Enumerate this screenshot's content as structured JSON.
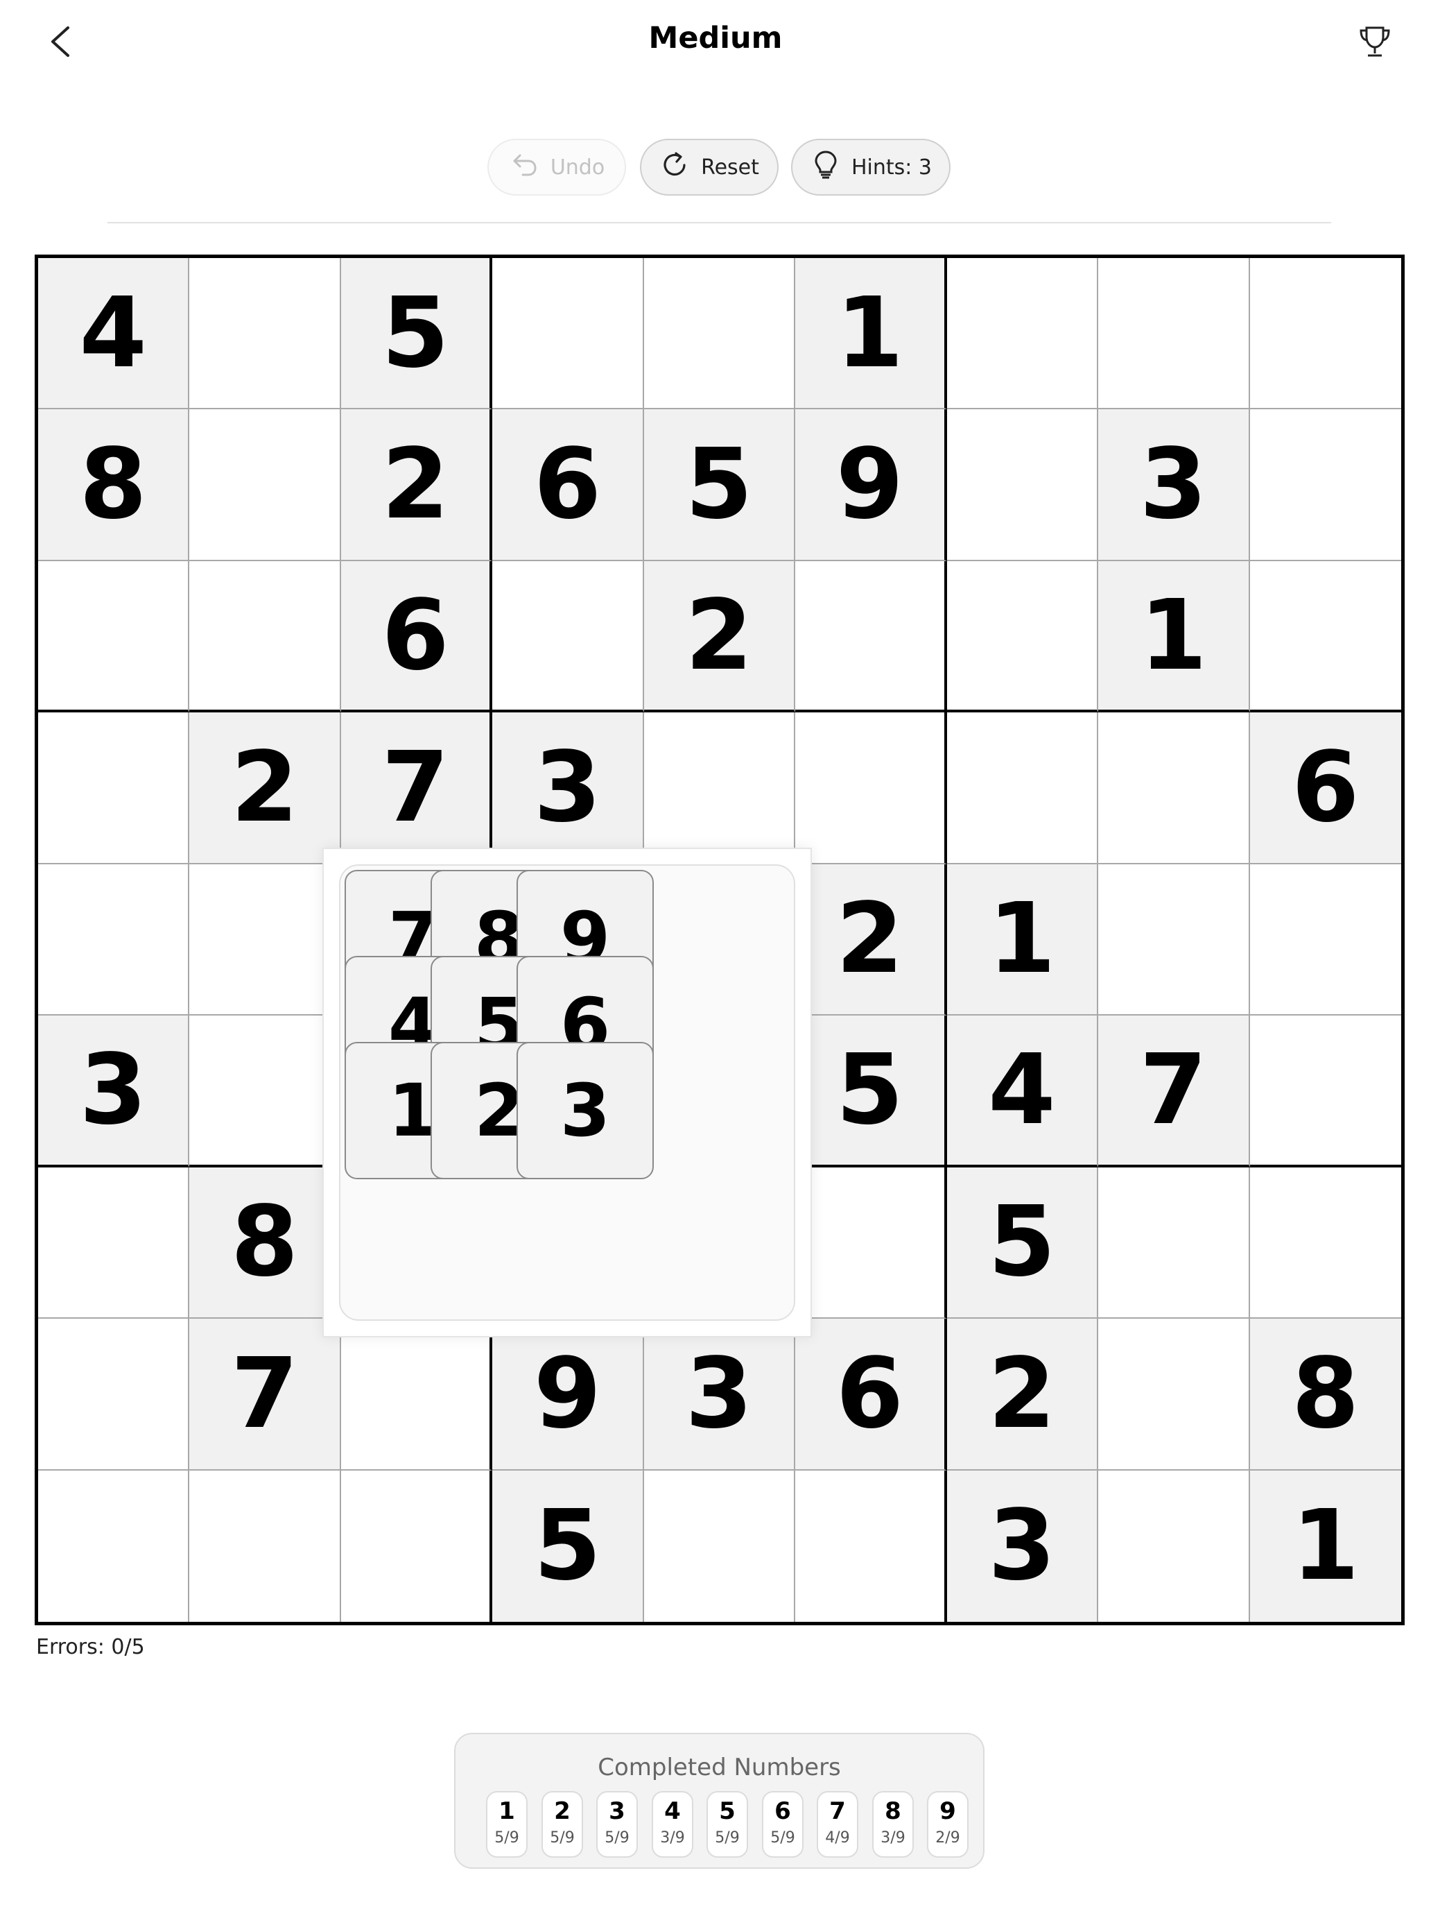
{
  "header": {
    "title": "Medium"
  },
  "toolbar": {
    "undo_label": "Undo",
    "reset_label": "Reset",
    "hints_label": "Hints: 3"
  },
  "board": {
    "rows": [
      [
        "4",
        "",
        "5",
        "",
        "",
        "1",
        "",
        "",
        ""
      ],
      [
        "8",
        "",
        "2",
        "6",
        "5",
        "9",
        "",
        "3",
        ""
      ],
      [
        "",
        "",
        "6",
        "",
        "2",
        "",
        "",
        "1",
        ""
      ],
      [
        "",
        "2",
        "7",
        "3",
        "",
        "",
        "",
        "",
        "6"
      ],
      [
        "",
        "",
        "",
        "",
        "",
        "2",
        "1",
        "",
        ""
      ],
      [
        "3",
        "",
        "",
        "",
        "",
        "5",
        "4",
        "7",
        ""
      ],
      [
        "",
        "8",
        "",
        "",
        "",
        "",
        "5",
        "",
        ""
      ],
      [
        "",
        "7",
        "",
        "9",
        "3",
        "6",
        "2",
        "",
        "8"
      ],
      [
        "",
        "",
        "",
        "5",
        "",
        "",
        "3",
        "",
        "1"
      ]
    ]
  },
  "numpad": {
    "keys": [
      "7",
      "8",
      "9",
      "4",
      "5",
      "6",
      "1",
      "2",
      "3"
    ]
  },
  "status": {
    "errors": "Errors: 0/5"
  },
  "completed": {
    "title": "Completed Numbers",
    "items": [
      {
        "number": "1",
        "count": "5/9"
      },
      {
        "number": "2",
        "count": "5/9"
      },
      {
        "number": "3",
        "count": "5/9"
      },
      {
        "number": "4",
        "count": "3/9"
      },
      {
        "number": "5",
        "count": "5/9"
      },
      {
        "number": "6",
        "count": "5/9"
      },
      {
        "number": "7",
        "count": "4/9"
      },
      {
        "number": "8",
        "count": "3/9"
      },
      {
        "number": "9",
        "count": "2/9"
      }
    ]
  },
  "colors": {
    "given_cell_bg": "#f1f1f1",
    "grid_line": "#a8a8a8",
    "box_line": "#000000"
  }
}
